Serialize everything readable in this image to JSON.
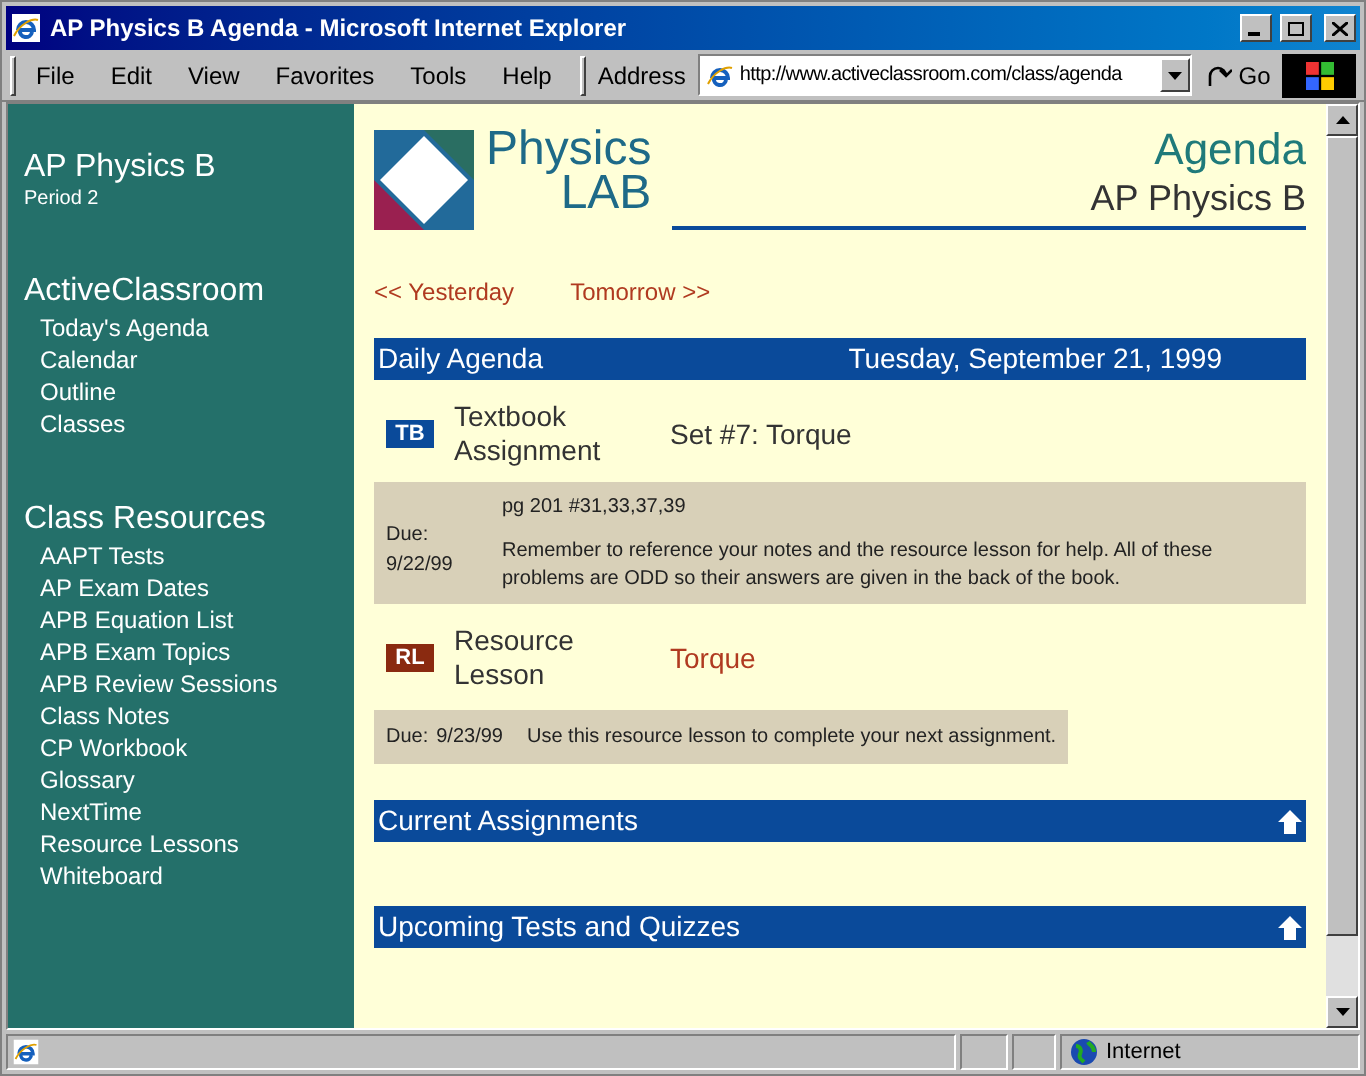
{
  "window": {
    "title": "AP Physics B Agenda - Microsoft Internet Explorer"
  },
  "menu": [
    "File",
    "Edit",
    "View",
    "Favorites",
    "Tools",
    "Help"
  ],
  "address": {
    "label": "Address",
    "value": "http://www.activeclassroom.com/class/agenda"
  },
  "go_button": "Go",
  "sidebar": {
    "course": "AP Physics B",
    "period": "Period 2",
    "sections": [
      {
        "heading": "ActiveClassroom",
        "items": [
          "Today's Agenda",
          "Calendar",
          "Outline",
          "Classes"
        ]
      },
      {
        "heading": "Class Resources",
        "items": [
          "AAPT Tests",
          "AP Exam Dates",
          "APB Equation List",
          "APB Exam Topics",
          "APB Review Sessions",
          "Class Notes",
          "CP Workbook",
          "Glossary",
          "NextTime",
          "Resource Lessons",
          "Whiteboard"
        ]
      }
    ]
  },
  "header": {
    "logo_top": "Physics",
    "logo_bottom": "LAB",
    "title": "Agenda",
    "subtitle": "AP Physics B"
  },
  "nav": [
    "<< Yesterday",
    "Tomorrow >>"
  ],
  "agenda": {
    "label": "Daily Agenda",
    "date": "Tuesday, September 21, 1999",
    "entries": [
      {
        "kind": "textbook",
        "badge": "TB",
        "type": "Textbook Assignment",
        "title": "Set #7: Torque",
        "due_label": "Due:",
        "due_date": "9/22/99",
        "reference": "pg 201 #31,33,37,39",
        "note": "Remember to reference your notes and the resource lesson for help. All of these problems are ODD so their answers are given in the back of the book."
      },
      {
        "kind": "resource",
        "badge": "RL",
        "type": "Resource Lesson",
        "title": "Torque",
        "due_label": "Due:",
        "due_date": "9/23/99",
        "note": "Use this resource lesson to complete your next assignment."
      }
    ]
  },
  "sections": [
    {
      "title": "Current Assignments"
    },
    {
      "title": "Upcoming Tests and Quizzes"
    }
  ],
  "status_bar": {
    "zone": "Internet"
  }
}
